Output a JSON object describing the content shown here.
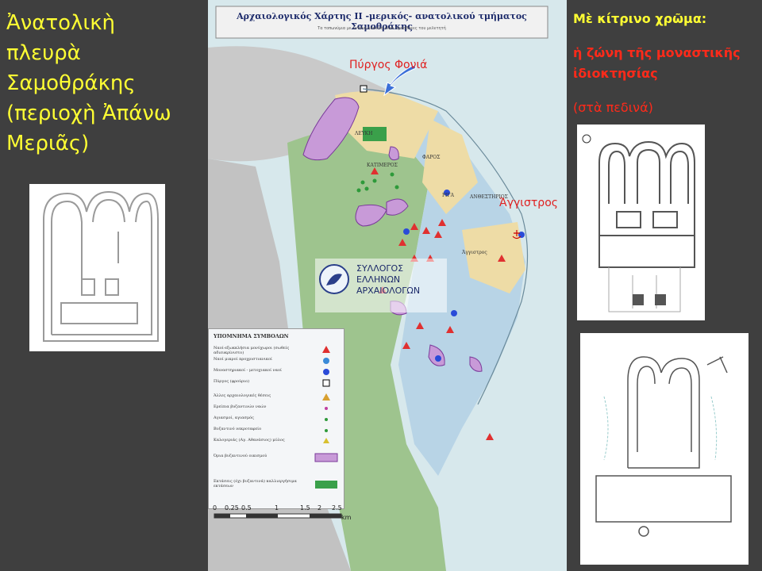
{
  "slide": {
    "left_title": [
      "Ἀνατολικὴ",
      "πλευρὰ",
      "Σαμοθράκης",
      "(περιοχὴ Ἀπάνω",
      "Μεριᾶς)"
    ],
    "yellow_title": "Μὲ κίτρινο χρῶμα:",
    "yellow_desc": "ἡ ζώνη τῆς μοναστικῆς ἰδιοκτησίας",
    "yellow_note": "(στὰ πεδινά)"
  },
  "map": {
    "title": "Αρχαιολογικός Χάρτης ΙΙ -μερικός- ανατολικού τμήματος Σαμοθράκης",
    "subtitle": "Τα τοπωνύμια με έντονα κόκκινα είναι προσθήκες του μελετητή",
    "callout_tower": "Πύργος Φονιά",
    "callout_cape": "Άγγιστρος",
    "watermark": [
      "ΣΥΛΛΟΓΟΣ",
      "ΕΛΛΗΝΩΝ",
      "ΑΡΧΑΙΟΛΟΓΩΝ"
    ],
    "legend": {
      "title": "ΥΠΟΜΝΗΜΑ ΣΥΜΒΟΛΩΝ",
      "items": [
        "Ναοί-εξωκκλήσια μονύχωροι (σωθείς αδιευκρίνιστο)",
        "Ναοί μικροί προχριστιανικοί",
        "Μοναστηριακοί - μετοχιακοί ναοί",
        "Πύργος (φρούριο)",
        "Άλλες αρχαιολογικές θέσεις",
        "Ερείπια βυζαντινών ναών",
        "Αγιασμοί, αγιασμός",
        "Βυζαντινό νεκροταφείο",
        "Καλογεριάς (Αγ. Αθανάσιος) μύλος",
        "Όρια βυζαντινού οικισμού",
        "Εκτάσεις (όχι βυζαντινά) καλλιεργήσιμα εκτάσεων"
      ],
      "colors": {
        "church": "#e03030",
        "monastery": "#2a4bd8",
        "green_dot": "#2e9a3a",
        "settlement": "#c89ad8",
        "cultivated": "#3aa04a"
      }
    },
    "scale": {
      "ticks": [
        "0",
        "0.25",
        "0.5",
        "1",
        "1.5",
        "2",
        "2.5"
      ],
      "unit": "km"
    },
    "colors": {
      "sea": "#d7e8ec",
      "land_green": "#9ec48e",
      "land_blue": "#b8d4e6",
      "land_yellow": "#eedca6",
      "hill_grey": "#c9c9c9"
    }
  }
}
